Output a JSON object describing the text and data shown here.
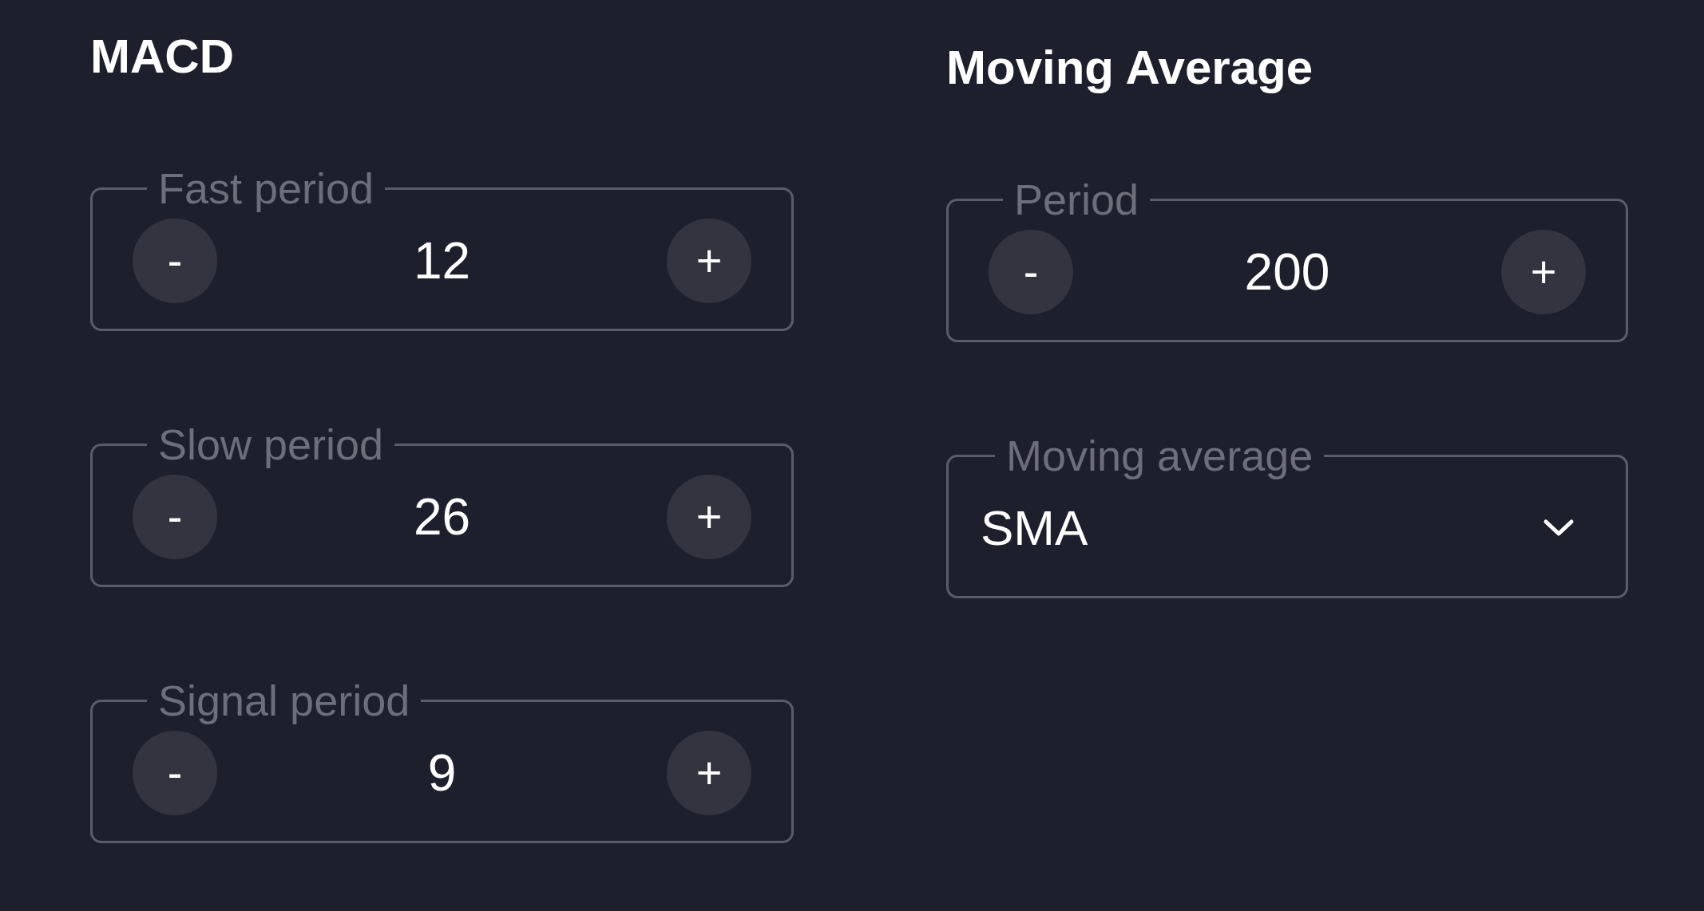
{
  "sections": [
    {
      "title": "MACD",
      "fields": [
        {
          "kind": "stepper",
          "label": "Fast period",
          "value": "12",
          "decrement": "-",
          "increment": "+"
        },
        {
          "kind": "stepper",
          "label": "Slow period",
          "value": "26",
          "decrement": "-",
          "increment": "+"
        },
        {
          "kind": "stepper",
          "label": "Signal period",
          "value": "9",
          "decrement": "-",
          "increment": "+"
        }
      ]
    },
    {
      "title": "Moving Average",
      "fields": [
        {
          "kind": "stepper",
          "label": "Period",
          "value": "200",
          "decrement": "-",
          "increment": "+"
        },
        {
          "kind": "select",
          "label": "Moving average",
          "value": "SMA"
        }
      ]
    }
  ]
}
